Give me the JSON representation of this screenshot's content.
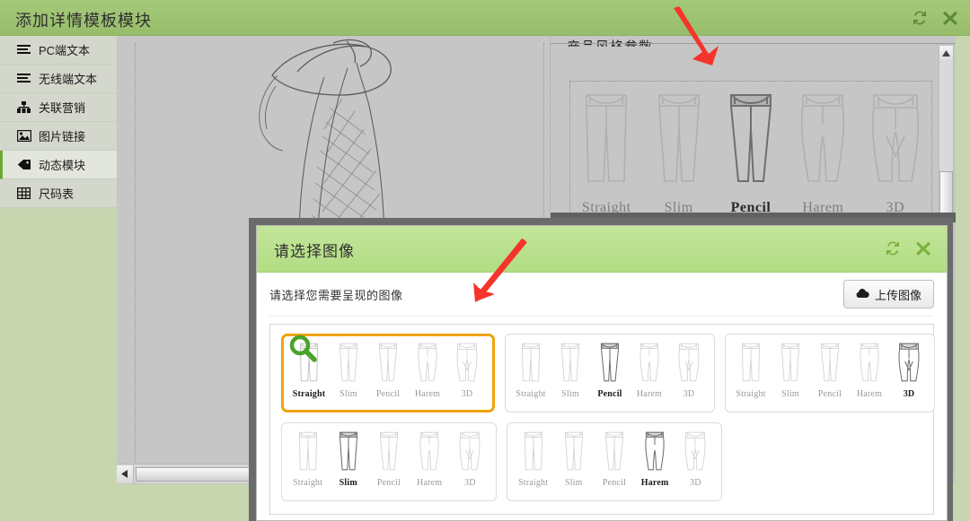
{
  "window": {
    "title": "添加详情模板模块",
    "controls": [
      {
        "name": "refresh-icon",
        "label": "刷新"
      },
      {
        "name": "close-icon",
        "label": "关闭"
      }
    ]
  },
  "sidebar": {
    "items": [
      {
        "label": "PC端文本",
        "icon": "lines-icon",
        "active": false
      },
      {
        "label": "无线端文本",
        "icon": "lines-icon",
        "active": false
      },
      {
        "label": "关联营销",
        "icon": "sitemap-icon",
        "active": false
      },
      {
        "label": "图片链接",
        "icon": "image-icon",
        "active": false
      },
      {
        "label": "动态模块",
        "icon": "tag-icon",
        "active": true
      },
      {
        "label": "尺码表",
        "icon": "table-icon",
        "active": false
      }
    ]
  },
  "right_panel": {
    "clipped_heading": "产品风格参数",
    "strip": {
      "items": [
        {
          "label": "Straight",
          "selected": false
        },
        {
          "label": "Slim",
          "selected": false
        },
        {
          "label": "Pencil",
          "selected": true
        },
        {
          "label": "Harem",
          "selected": false
        },
        {
          "label": "3D",
          "selected": false
        }
      ]
    }
  },
  "modal": {
    "title": "请选择图像",
    "controls": [
      {
        "name": "refresh-icon",
        "label": "刷新"
      },
      {
        "name": "close-icon",
        "label": "关闭"
      }
    ],
    "subtitle": "请选择您需要呈现的图像",
    "upload_button": {
      "label": "上传图像",
      "icon": "cloud-upload-icon"
    },
    "gallery": {
      "rows": [
        [
          {
            "selected": true,
            "has_magnifier": true,
            "items": [
              {
                "label": "Straight",
                "highlighted": true
              },
              {
                "label": "Slim",
                "highlighted": false
              },
              {
                "label": "Pencil",
                "highlighted": false
              },
              {
                "label": "Harem",
                "highlighted": false
              },
              {
                "label": "3D",
                "highlighted": false
              }
            ]
          },
          {
            "selected": false,
            "has_magnifier": false,
            "items": [
              {
                "label": "Straight",
                "highlighted": false
              },
              {
                "label": "Slim",
                "highlighted": false
              },
              {
                "label": "Pencil",
                "highlighted": true
              },
              {
                "label": "Harem",
                "highlighted": false
              },
              {
                "label": "3D",
                "highlighted": false
              }
            ]
          },
          {
            "selected": false,
            "has_magnifier": false,
            "items": [
              {
                "label": "Straight",
                "highlighted": false
              },
              {
                "label": "Slim",
                "highlighted": false
              },
              {
                "label": "Pencil",
                "highlighted": false
              },
              {
                "label": "Harem",
                "highlighted": false
              },
              {
                "label": "3D",
                "highlighted": true
              }
            ]
          }
        ],
        [
          {
            "selected": false,
            "has_magnifier": false,
            "items": [
              {
                "label": "Straight",
                "highlighted": false
              },
              {
                "label": "Slim",
                "highlighted": true
              },
              {
                "label": "Pencil",
                "highlighted": false
              },
              {
                "label": "Harem",
                "highlighted": false
              },
              {
                "label": "3D",
                "highlighted": false
              }
            ]
          },
          {
            "selected": false,
            "has_magnifier": false,
            "items": [
              {
                "label": "Straight",
                "highlighted": false
              },
              {
                "label": "Slim",
                "highlighted": false
              },
              {
                "label": "Pencil",
                "highlighted": false
              },
              {
                "label": "Harem",
                "highlighted": true
              },
              {
                "label": "3D",
                "highlighted": false
              }
            ]
          }
        ]
      ]
    }
  },
  "annotations": [
    {
      "name": "red-arrow-top",
      "target": "style-strip"
    },
    {
      "name": "red-arrow-modal",
      "target": "gallery"
    }
  ],
  "colors": {
    "header_green": "#97bd6b",
    "modal_header_green": "#b2dd84",
    "selected_orange": "#f0a30a",
    "accent_green": "#5aa832",
    "annotation_red": "#f5342b",
    "canvas_gray": "#c6c6c6",
    "page_bg": "#c8d6b0"
  }
}
